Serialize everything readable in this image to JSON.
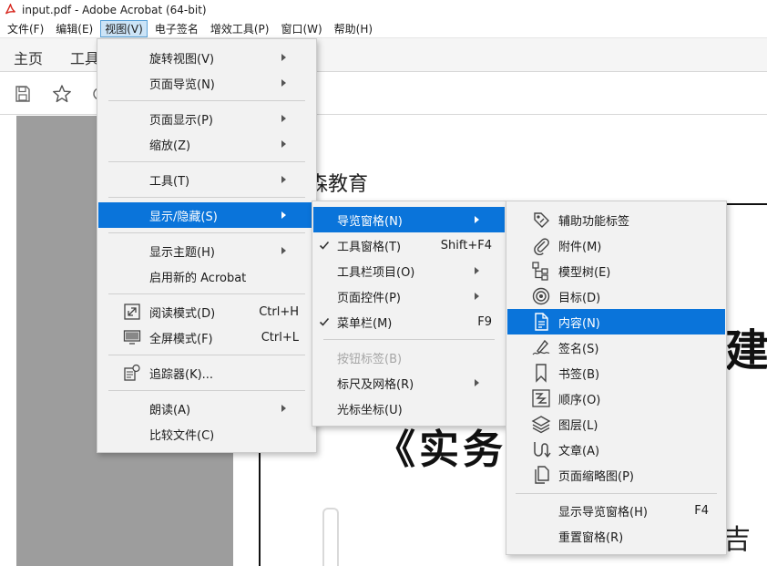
{
  "window": {
    "title": "input.pdf - Adobe Acrobat (64-bit)"
  },
  "menubar": [
    {
      "label": "文件(F)"
    },
    {
      "label": "编辑(E)"
    },
    {
      "label": "视图(V)"
    },
    {
      "label": "电子签名"
    },
    {
      "label": "增效工具(P)"
    },
    {
      "label": "窗口(W)"
    },
    {
      "label": "帮助(H)"
    }
  ],
  "tabs": {
    "home": "主页",
    "tools": "工具"
  },
  "document": {
    "header_text": "森教育",
    "big_char_1": "建",
    "big_text_2": "《实务",
    "big_char_3": "吉"
  },
  "view_menu": {
    "rotate": "旋转视图(V)",
    "page_nav": "页面导览(N)",
    "page_display": "页面显示(P)",
    "zoom": "缩放(Z)",
    "tools": "工具(T)",
    "show_hide": "显示/隐藏(S)",
    "theme": "显示主题(H)",
    "new_acrobat": "启用新的 Acrobat",
    "read_mode": "阅读模式(D)",
    "read_mode_sc": "Ctrl+H",
    "full_screen": "全屏模式(F)",
    "full_screen_sc": "Ctrl+L",
    "tracker": "追踪器(K)...",
    "read_aloud": "朗读(A)",
    "compare": "比较文件(C)"
  },
  "showhide_menu": {
    "nav_panes": "导览窗格(N)",
    "tools_pane": "工具窗格(T)",
    "tools_pane_sc": "Shift+F4",
    "toolbar_items": "工具栏项目(O)",
    "page_controls": "页面控件(P)",
    "menu_bar": "菜单栏(M)",
    "menu_bar_sc": "F9",
    "button_labels": "按钮标签(B)",
    "rulers_grids": "标尺及网格(R)",
    "cursor_coords": "光标坐标(U)"
  },
  "nav_menu": {
    "accessibility_tags": "辅助功能标签",
    "attachments": "附件(M)",
    "model_tree": "模型树(E)",
    "destinations": "目标(D)",
    "content": "内容(N)",
    "signatures": "签名(S)",
    "bookmarks": "书签(B)",
    "order": "顺序(O)",
    "layers": "图层(L)",
    "articles": "文章(A)",
    "page_thumbnails": "页面缩略图(P)",
    "show_nav_pane": "显示导览窗格(H)",
    "show_nav_pane_sc": "F4",
    "reset_panes": "重置窗格(R)"
  },
  "colors": {
    "highlight": "#0a74da",
    "menu_bg": "#f2f2f2",
    "menubar_active": "#cce4f7",
    "doc_background": "#9d9d9d"
  }
}
